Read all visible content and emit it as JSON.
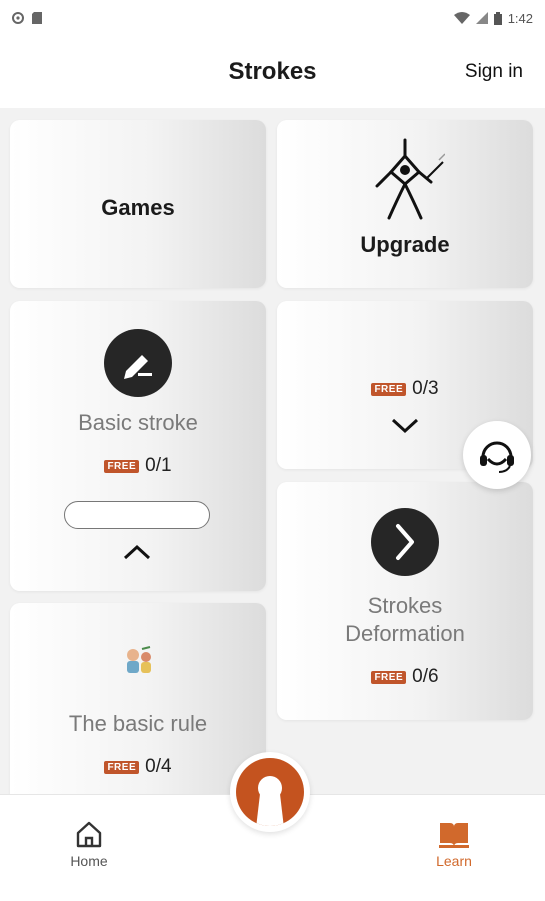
{
  "status_bar": {
    "time": "1:42"
  },
  "header": {
    "title": "Strokes",
    "sign_in": "Sign in"
  },
  "cards": {
    "games": {
      "label": "Games"
    },
    "upgrade": {
      "label": "Upgrade"
    },
    "basic_stroke": {
      "title": "Basic stroke",
      "badge": "FREE",
      "progress": "0/1"
    },
    "collapsed": {
      "badge": "FREE",
      "progress": "0/3"
    },
    "strokes_deformation": {
      "title_line1": "Strokes",
      "title_line2": "Deformation",
      "badge": "FREE",
      "progress": "0/6"
    },
    "basic_rule": {
      "title": "The basic rule",
      "badge": "FREE",
      "progress": "0/4"
    }
  },
  "bottom_nav": {
    "home": "Home",
    "learn": "Learn",
    "active": "learn",
    "active_color": "#d1692c"
  },
  "colors": {
    "accent": "#c4531f",
    "free_badge": "#c0552b"
  },
  "icons": [
    "pencil-icon",
    "chevron-up-icon",
    "chevron-down-icon",
    "s-curve-icon",
    "headset-icon",
    "home-icon",
    "book-icon",
    "warrior-logo-icon"
  ]
}
